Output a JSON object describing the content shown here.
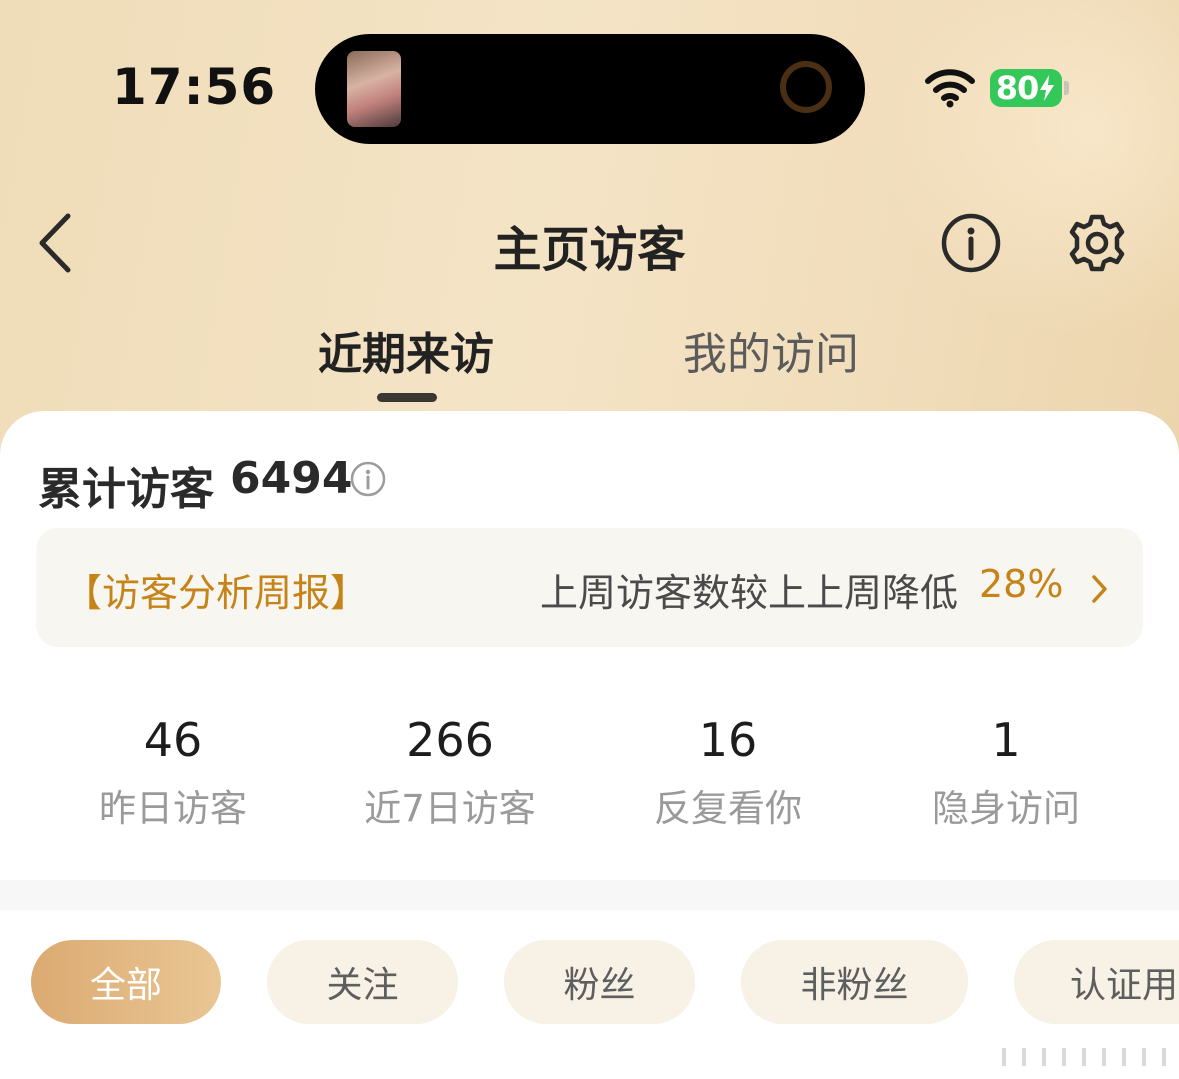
{
  "status_bar": {
    "time": "17:56",
    "battery": "80",
    "icons": [
      "wifi-icon",
      "battery-charging-icon"
    ]
  },
  "nav": {
    "title": "主页访客",
    "icons": [
      "back-icon",
      "info-icon",
      "gear-icon"
    ]
  },
  "tabs": [
    {
      "label": "近期来访",
      "active": true
    },
    {
      "label": "我的访问",
      "active": false
    }
  ],
  "summary": {
    "total_label": "累计访客",
    "total_value": "6494"
  },
  "report": {
    "title": "【访客分析周报】",
    "text": "上周访客数较上上周降低",
    "percent": "28%"
  },
  "stats": [
    {
      "value": "46",
      "label": "昨日访客"
    },
    {
      "value": "266",
      "label": "近7日访客"
    },
    {
      "value": "16",
      "label": "反复看你"
    },
    {
      "value": "1",
      "label": "隐身访问"
    }
  ],
  "filters": [
    {
      "label": "全部",
      "active": true
    },
    {
      "label": "关注",
      "active": false
    },
    {
      "label": "粉丝",
      "active": false
    },
    {
      "label": "非粉丝",
      "active": false
    },
    {
      "label": "认证用",
      "active": false
    }
  ],
  "colors": {
    "accent": "#c58318",
    "chip_active": "#dcaa72",
    "battery": "#34c759"
  }
}
